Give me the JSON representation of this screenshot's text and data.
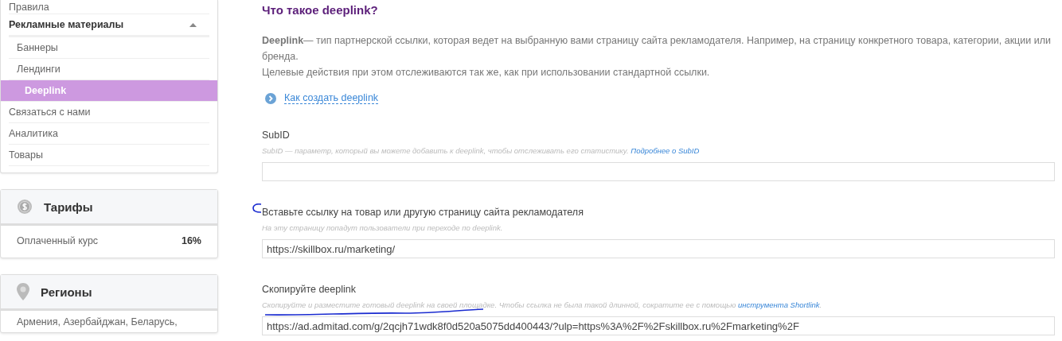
{
  "sidebar": {
    "menu": [
      {
        "label": "Правила",
        "kind": "item",
        "selected": false
      },
      {
        "label": "Рекламные материалы",
        "kind": "group",
        "expanded": true,
        "children": [
          {
            "label": "Баннеры",
            "selected": false
          },
          {
            "label": "Лендинги",
            "selected": false
          },
          {
            "label": "Deeplink",
            "selected": true
          }
        ]
      },
      {
        "label": "Связаться с нами",
        "kind": "item",
        "selected": false
      },
      {
        "label": "Аналитика",
        "kind": "item",
        "selected": false
      },
      {
        "label": "Товары",
        "kind": "item",
        "selected": false
      }
    ],
    "cards": [
      {
        "kind": "tariffs",
        "title": "Тарифы",
        "rows": [
          {
            "label": "Оплаченный курс",
            "value": "16%"
          }
        ]
      },
      {
        "kind": "regions",
        "title": "Регионы",
        "text": "Армения, Азербайджан, Беларусь,"
      }
    ]
  },
  "main": {
    "title": "Что такое deeplink?",
    "paragraphs": [
      "**Deeplink**— тип партнерской ссылки, которая ведет на выбранную вами страницу сайта рекламодателя. Например, на страницу конкретного товара, категории, акции или бренда.",
      "Целевые действия при этом отслеживаются так же, как при использовании стандартной ссылки."
    ],
    "how_to_link": "Как создать deeplink",
    "fields": [
      {
        "label": "SubID",
        "hint": "SubID — параметр, который вы можете добавить к deeplink, чтобы отслеживать его статистику.",
        "hint_link": "Подробнее о SubID"
      },
      {
        "label": "Вставьте ссылку на товар или другую страницу сайта рекламодателя",
        "hint": "На эту страницу попадут пользователи при переходе по deeplink.",
        "value": "https://skillbox.ru/marketing/",
        "pen_bracket": true
      },
      {
        "label": "Скопируйте deeplink",
        "hint": "Скопируйте и разместите готовый deeplink на своей площадке. Чтобы ссылка не была такой длинной, сократите ее с помощью",
        "hint_link": "инструмента Shortlink",
        "hint_end": ".",
        "value": "https://ad.admitad.com/g/2qcjh71wdk8f0d520a5075dd400443/?ulp=https%3A%2F%2Fskillbox.ru%2Fmarketing%2F",
        "pen_underline": true
      }
    ]
  }
}
